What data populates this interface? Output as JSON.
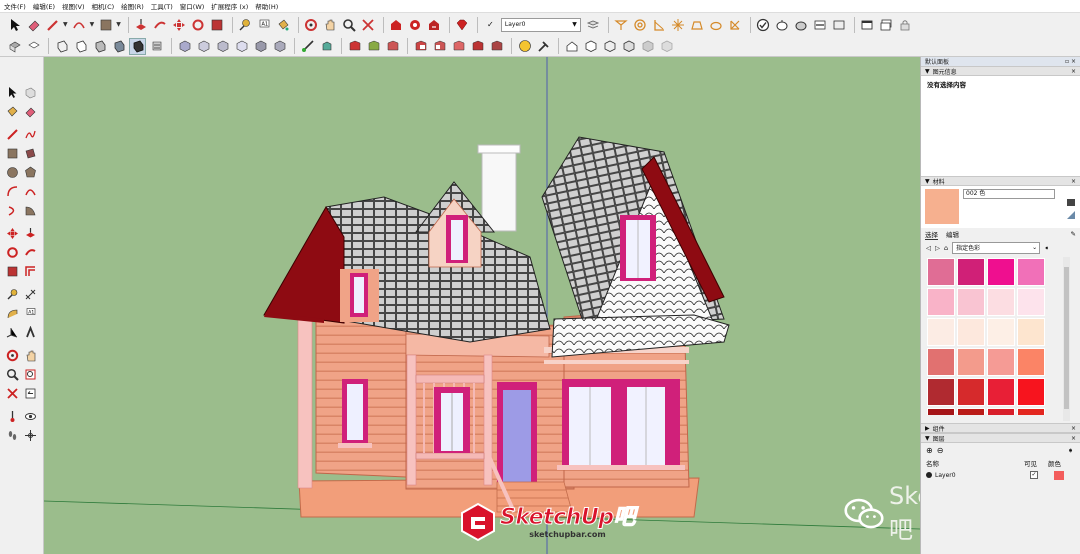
{
  "menu": [
    "文件(F)",
    "编辑(E)",
    "视图(V)",
    "相机(C)",
    "绘图(R)",
    "工具(T)",
    "窗口(W)",
    "扩展程序 (x)",
    "帮助(H)"
  ],
  "toolbar": {
    "layer_value": "Layer0",
    "layer_check": "✓"
  },
  "panel": {
    "title": "默认面板",
    "title_pin": "▫ ×",
    "entity": {
      "header": "图元信息",
      "body": "没有选择内容"
    },
    "materials": {
      "header": "材料",
      "name": "002 色",
      "swatch_color": "#f6b08f",
      "tab_select": "选择",
      "tab_edit": "编辑",
      "dropdown": "指定色彩",
      "swatches": [
        "#e06d95",
        "#d02077",
        "#ef0f8f",
        "#f170b8",
        "#f9b3c8",
        "#f9c4d2",
        "#fcdde2",
        "#fde3ec",
        "#fcece4",
        "#fde8dd",
        "#fdefe6",
        "#fde5cf",
        "#e17170",
        "#f39b8c",
        "#f59b95",
        "#fb8466",
        "#b02a30",
        "#d62a2c",
        "#e81f36",
        "#f7141e",
        "#a51417",
        "#ba1b17",
        "#d81e2a",
        "#e3261f"
      ]
    },
    "components": {
      "header": "组件"
    },
    "layers": {
      "header": "图层",
      "col_name": "名称",
      "col_visible": "可见",
      "col_color": "颜色",
      "row_name": "Layer0",
      "row_visible": "✓",
      "row_color": "#f35d5c"
    }
  },
  "watermark": {
    "brand": "SketchUp吧",
    "url": "sketchupbar.com",
    "wechat": "SketchUp吧"
  }
}
